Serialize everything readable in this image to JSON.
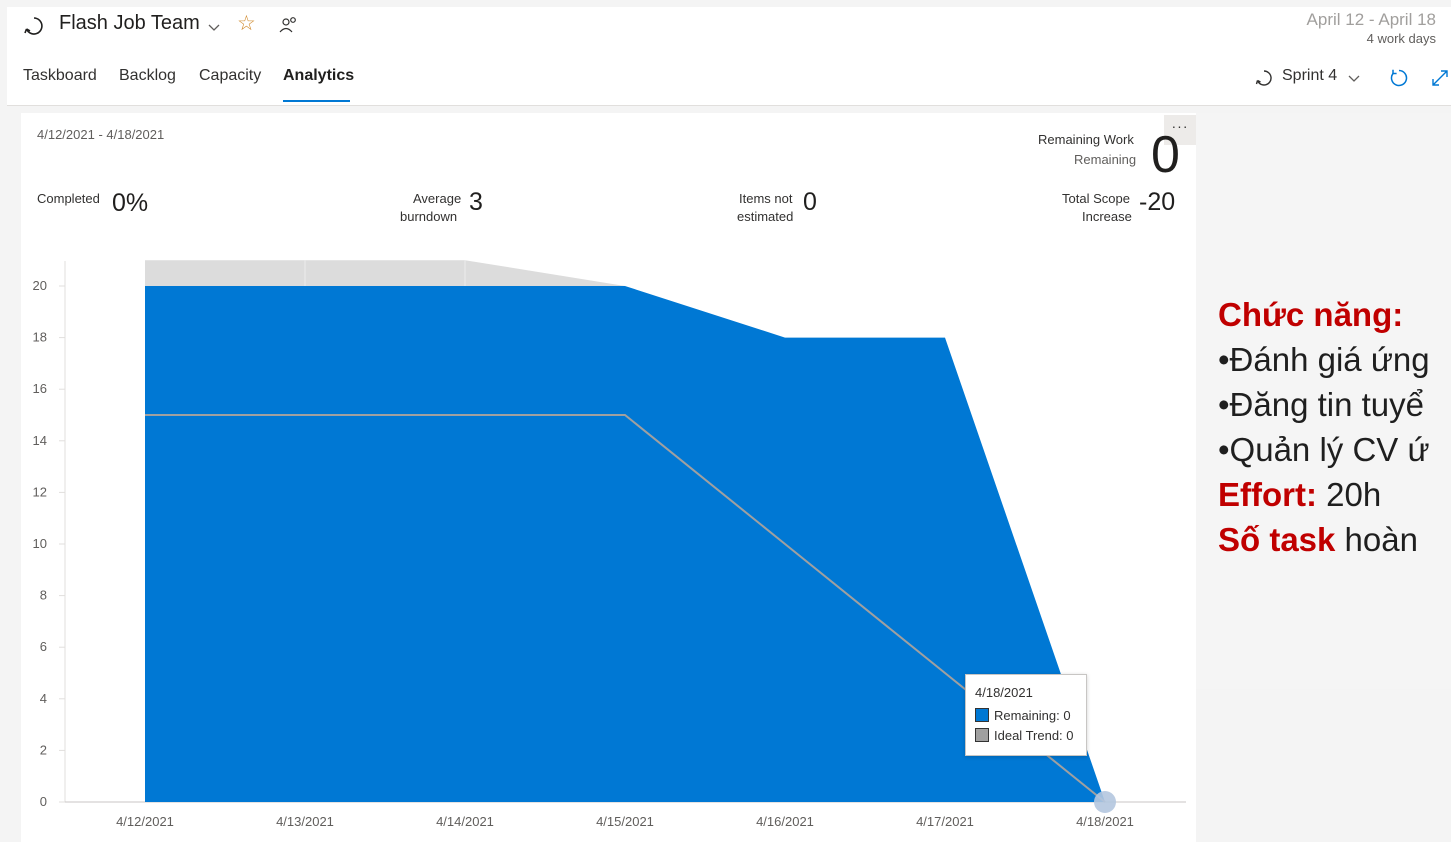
{
  "header": {
    "team_name": "Flash Job Team",
    "date_range": "April 12 - April 18",
    "work_days": "4 work days",
    "sprint": "Sprint 4",
    "tabs": [
      {
        "label": "Taskboard"
      },
      {
        "label": "Backlog"
      },
      {
        "label": "Capacity"
      },
      {
        "label": "Analytics",
        "active": true
      }
    ]
  },
  "burndown": {
    "date_range": "4/12/2021 - 4/18/2021",
    "more_label": "···",
    "remaining": {
      "title": "Remaining Work",
      "subtitle": "Remaining",
      "value": "0"
    },
    "completed": {
      "label": "Completed",
      "value": "0%"
    },
    "average": {
      "label_line1": "Average",
      "label_line2": "burndown",
      "value": "3"
    },
    "not_estimated": {
      "label_line1": "Items not",
      "label_line2": "estimated",
      "value": "0"
    },
    "scope": {
      "label_line1": "Total Scope",
      "label_line2": "Increase",
      "value": "-20"
    },
    "tooltip": {
      "date": "4/18/2021",
      "remaining": "Remaining: 0",
      "ideal": "Ideal Trend: 0"
    }
  },
  "chart_data": {
    "type": "area",
    "categories": [
      "4/12/2021",
      "4/13/2021",
      "4/14/2021",
      "4/15/2021",
      "4/16/2021",
      "4/17/2021",
      "4/18/2021"
    ],
    "series": [
      {
        "name": "Remaining",
        "values": [
          20,
          20,
          20,
          20,
          18,
          18,
          0
        ],
        "color": "#0078d4"
      },
      {
        "name": "Ideal Trend",
        "values": [
          15,
          15,
          15,
          15,
          10,
          5,
          0
        ],
        "color": "#a0a0a0"
      },
      {
        "values": [
          21,
          21,
          21,
          20,
          18,
          18,
          0
        ],
        "color": "#dcdcdc"
      }
    ],
    "yticks": [
      0,
      2,
      4,
      6,
      8,
      10,
      12,
      14,
      16,
      18,
      20
    ],
    "ylim": [
      0,
      22
    ],
    "xlabel": "",
    "ylabel": "",
    "title": ""
  },
  "notes": {
    "line1_red": "Chức năng:",
    "line2": "•Đánh giá ứng",
    "line3": "•Đăng tin tuyể",
    "line4": "•Quản lý CV ứ",
    "line5_red": "Effort:",
    "line5_rest": " 20h",
    "line6_red": "Số task",
    "line6_rest": " hoàn"
  },
  "colors": {
    "accent": "#0078d4",
    "note_red": "#c00000",
    "ideal_line": "#a0a0a0",
    "scope_band": "#dcdcdc"
  }
}
